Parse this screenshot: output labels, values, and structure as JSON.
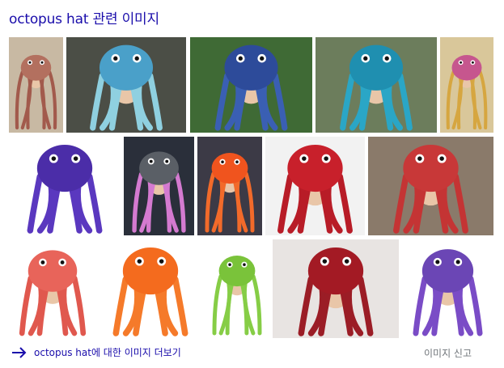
{
  "header": {
    "title": "octopus hat 관련 이미지"
  },
  "images": [
    {
      "alt": "octopus hat image 1",
      "bg": "#c8b9a3",
      "hat": "#b3705f",
      "tent": "#a25a4c"
    },
    {
      "alt": "octopus hat image 2",
      "bg": "#4b4e46",
      "hat": "#4aa0c9",
      "tent": "#8fd0e0"
    },
    {
      "alt": "octopus hat image 3",
      "bg": "#3f6a35",
      "hat": "#2d4b9a",
      "tent": "#3a5fb3"
    },
    {
      "alt": "octopus hat image 4",
      "bg": "#6c7d5c",
      "hat": "#1f8fb0",
      "tent": "#2aa6c6"
    },
    {
      "alt": "octopus hat image 5",
      "bg": "#d9c79a",
      "hat": "#c6568e",
      "tent": "#d6a640"
    },
    {
      "alt": "octopus hat image 6",
      "bg": "#ffffff",
      "hat": "#4b2da8",
      "tent": "#5a38bf"
    },
    {
      "alt": "octopus hat image 7",
      "bg": "#2a2f3a",
      "hat": "#5a5f66",
      "tent": "#d47ad0"
    },
    {
      "alt": "octopus hat image 8",
      "bg": "#3c3a46",
      "hat": "#f0541e",
      "tent": "#f26a2a"
    },
    {
      "alt": "octopus hat image 9",
      "bg": "#f2f2f2",
      "hat": "#c8202b",
      "tent": "#b81c27"
    },
    {
      "alt": "octopus hat image 10",
      "bg": "#8a7a6a",
      "hat": "#c83838",
      "tent": "#c43434"
    },
    {
      "alt": "octopus hat image 11",
      "bg": "#ffffff",
      "hat": "#e8645a",
      "tent": "#e0584e"
    },
    {
      "alt": "octopus hat image 12",
      "bg": "#ffffff",
      "hat": "#f46b1e",
      "tent": "#f57a2a"
    },
    {
      "alt": "octopus hat image 13",
      "bg": "#ffffff",
      "hat": "#7ac33a",
      "tent": "#86cd46"
    },
    {
      "alt": "octopus hat image 14",
      "bg": "#e8e4e2",
      "hat": "#a31a24",
      "tent": "#9b1d26"
    },
    {
      "alt": "octopus hat image 15",
      "bg": "#ffffff",
      "hat": "#6b46b5",
      "tent": "#7a4cc6"
    }
  ],
  "footer": {
    "more_label": "octopus hat에 대한 이미지 더보기",
    "report_label": "이미지 신고"
  },
  "colors": {
    "link": "#1a0dab",
    "muted": "#70757a"
  }
}
